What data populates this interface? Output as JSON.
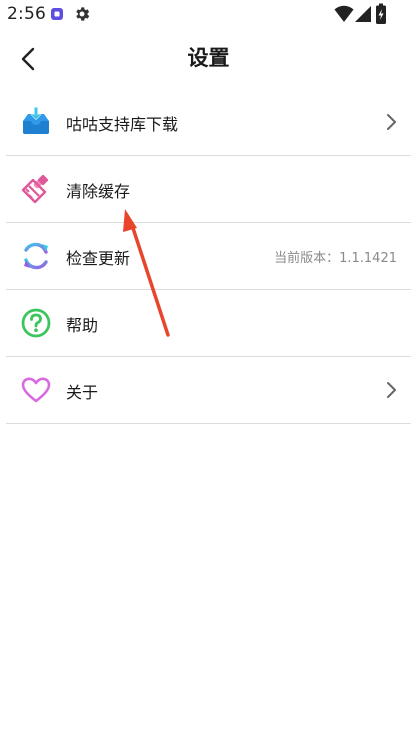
{
  "status_bar": {
    "time": "2:56"
  },
  "header": {
    "title": "设置"
  },
  "settings": [
    {
      "label": "咕咕支持库下载",
      "icon": "download-tray-icon",
      "value": "",
      "chevron": true
    },
    {
      "label": "清除缓存",
      "icon": "broom-icon",
      "value": "",
      "chevron": false
    },
    {
      "label": "检查更新",
      "icon": "refresh-icon",
      "value": "当前版本：1.1.1421",
      "chevron": false
    },
    {
      "label": "帮助",
      "icon": "help-icon",
      "value": "",
      "chevron": false
    },
    {
      "label": "关于",
      "icon": "heart-icon",
      "value": "",
      "chevron": true
    }
  ],
  "colors": {
    "download_icon": "#2f9be8",
    "broom_icon": "#e0589a",
    "refresh_icon_start": "#3cc7e8",
    "refresh_icon_end": "#9b5de5",
    "help_icon": "#3cc55c",
    "heart_icon": "#d86be0",
    "annotation_arrow": "#e8452c"
  }
}
